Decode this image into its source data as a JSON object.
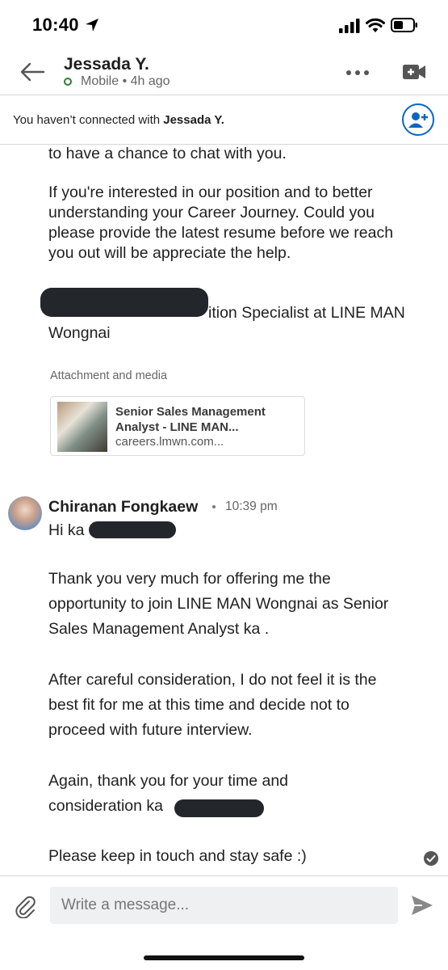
{
  "status_bar": {
    "time": "10:40"
  },
  "header": {
    "name": "Jessada Y.",
    "presence": "Mobile • 4h ago",
    "icons": {
      "back": "arrow-left-icon",
      "more": "more-dots-icon",
      "video": "video-call-icon"
    }
  },
  "banner": {
    "prefix": "You haven’t connected with ",
    "name": "Jessada Y.",
    "action_icon": "add-connection-icon"
  },
  "message1": {
    "line_a": "to have a chance to chat with you.",
    "paragraph": "If you're interested in our position and to better\nunderstanding your Career Journey. Could you\nplease provide the latest resume before we reach\nyou out will be appreciate the help.",
    "sig_fragment": "ition Specialist at LINE MAN",
    "sig_line2": "Wongnai",
    "attachment_label": "Attachment and media",
    "attachment": {
      "title": "Senior Sales Management Analyst - LINE MAN...",
      "url": "careers.lmwn.com..."
    }
  },
  "message2": {
    "sender": "Chiranan Fongkaew",
    "time": "10:39 pm",
    "greeting": "Hi ka",
    "p1": "Thank you very much for offering me the\nopportunity to join LINE MAN Wongnai as Senior\nSales Management Analyst ka .",
    "p2": "After careful consideration, I do not feel it is the\nbest fit for me at this time and decide not to\nproceed with future interview.",
    "p3a": "Again, thank you for your time and",
    "p3b": "consideration ka",
    "p4": "Please keep in touch and stay safe :)"
  },
  "composer": {
    "placeholder": "Write a message...",
    "attach_icon": "paperclip-icon",
    "send_icon": "send-icon"
  },
  "colors": {
    "accent": "#0a66c2",
    "online": "#2e7d32",
    "redaction": "#23272b"
  }
}
